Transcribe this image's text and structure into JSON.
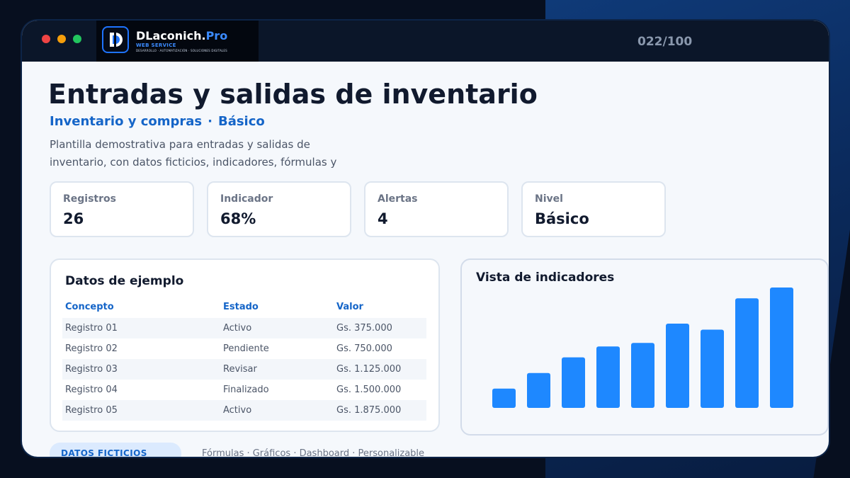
{
  "header": {
    "brand_name": "DLaconich.",
    "brand_accent": "Pro",
    "brand_sub": "WEB SERVICE",
    "brand_tagline": "DESARROLLO · AUTOMATIZACIÓN · SOLUCIONES DIGITALES",
    "counter": "022/100"
  },
  "main": {
    "title": "Entradas y salidas de inventario",
    "category": "Inventario y compras",
    "separator": "·",
    "level": "Básico",
    "description": "Plantilla demostrativa para entradas y salidas de inventario, con datos ficticios, indicadores, fórmulas y"
  },
  "stats": [
    {
      "label": "Registros",
      "value": "26"
    },
    {
      "label": "Indicador",
      "value": "68%"
    },
    {
      "label": "Alertas",
      "value": "4"
    },
    {
      "label": "Nivel",
      "value": "Básico"
    }
  ],
  "table": {
    "title": "Datos de ejemplo",
    "columns": [
      "Concepto",
      "Estado",
      "Valor"
    ],
    "rows": [
      [
        "Registro 01",
        "Activo",
        "Gs. 375.000"
      ],
      [
        "Registro 02",
        "Pendiente",
        "Gs. 750.000"
      ],
      [
        "Registro 03",
        "Revisar",
        "Gs. 1.125.000"
      ],
      [
        "Registro 04",
        "Finalizado",
        "Gs. 1.500.000"
      ],
      [
        "Registro 05",
        "Activo",
        "Gs. 1.875.000"
      ]
    ]
  },
  "chart_data": {
    "type": "bar",
    "title": "Vista de indicadores",
    "values": [
      16,
      29,
      42,
      51,
      54,
      70,
      65,
      91,
      100
    ],
    "ylim": [
      0,
      100
    ],
    "grid": false,
    "color": "#1e88ff"
  },
  "footer": {
    "badge": "DATOS FICTICIOS",
    "features": "Fórmulas · Gráficos · Dashboard · Personalizable"
  },
  "colors": {
    "accent": "#1565c8",
    "bar": "#1e88ff",
    "dark": "#0b1629"
  }
}
